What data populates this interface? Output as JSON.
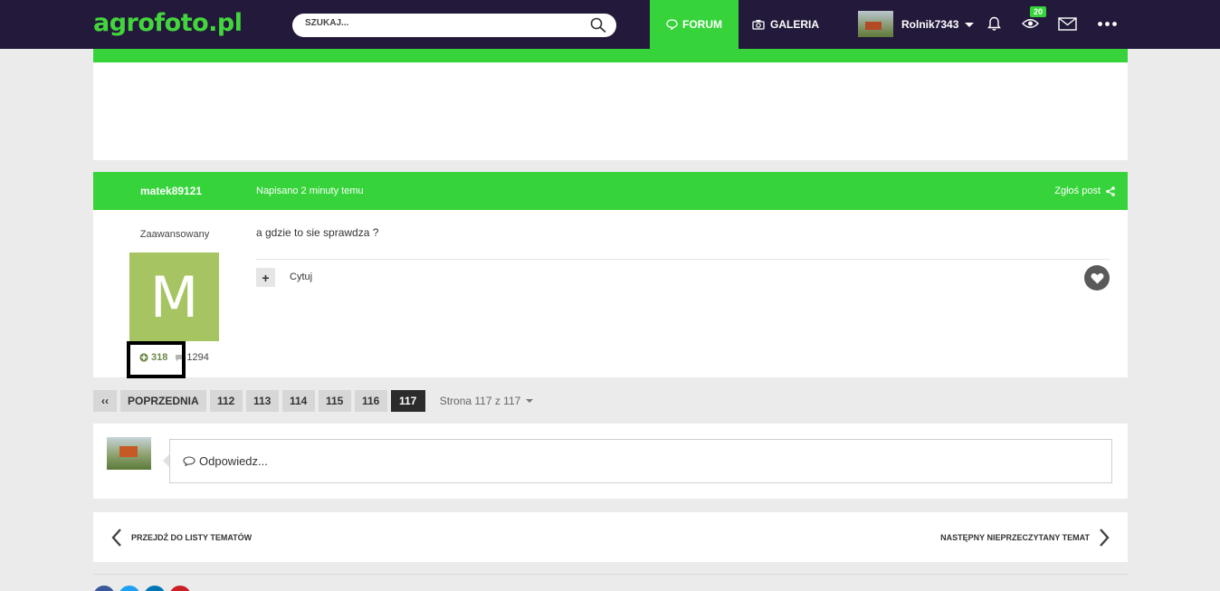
{
  "header": {
    "logo": "agrofoto.pl",
    "search_placeholder": "SZUKAJ...",
    "nav": {
      "forum": "FORUM",
      "gallery": "GALERIA"
    },
    "username": "Rolnik7343",
    "notification_badge": "20"
  },
  "post": {
    "author": "matek89121",
    "time": "Napisano 2 minuty temu",
    "report": "Zgłoś post",
    "rank": "Zaawansowany",
    "avatar_letter": "M",
    "reputation": "318",
    "post_count": "1294",
    "body": "a gdzie to sie sprawdza ?",
    "quote_label": "Cytuj"
  },
  "pagination": {
    "first": "‹‹",
    "previous": "POPRZEDNIA",
    "pages": [
      "112",
      "113",
      "114",
      "115",
      "116",
      "117"
    ],
    "current": "117",
    "page_of": "Strona 117 z 117"
  },
  "reply": {
    "placeholder": "Odpowiedz..."
  },
  "topic_nav": {
    "prev": "PRZEJDŹ DO LISTY TEMATÓW",
    "next": "NASTĘPNY NIEPRZECZYTANY TEMAT"
  },
  "colors": {
    "brand_green": "#36d43a",
    "topbar": "#23193a",
    "avatar_bg": "#a7c463"
  }
}
